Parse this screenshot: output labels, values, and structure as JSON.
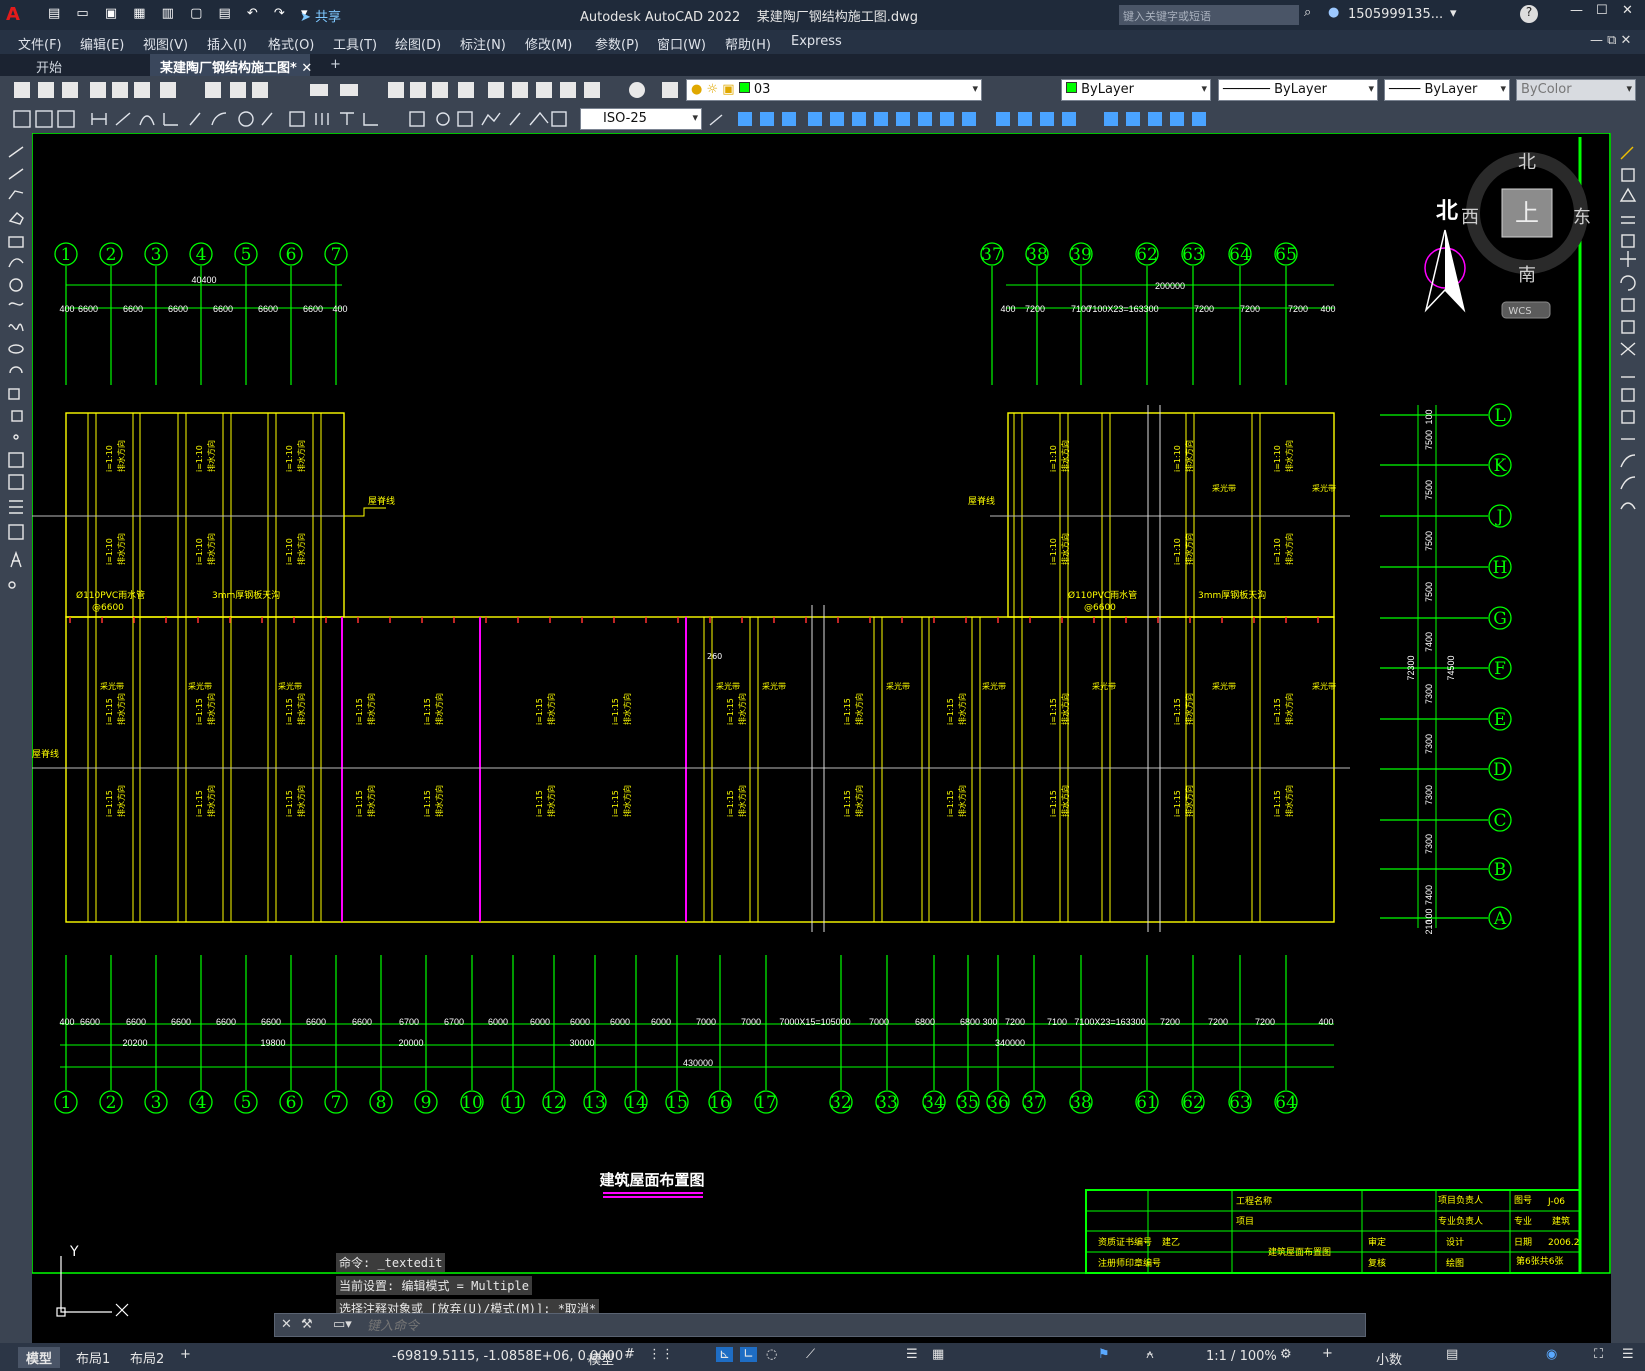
{
  "window": {
    "app_title": "Autodesk AutoCAD 2022",
    "file_title": "某建陶厂钢结构施工图.dwg",
    "share_label": "共享",
    "search_placeholder": "键入关键字或短语",
    "user": "1505999135...",
    "help_label": "?"
  },
  "menus": [
    "文件(F)",
    "编辑(E)",
    "视图(V)",
    "插入(I)",
    "格式(O)",
    "工具(T)",
    "绘图(D)",
    "标注(N)",
    "修改(M)",
    "参数(P)",
    "窗口(W)",
    "帮助(H)",
    "Express"
  ],
  "tabs": {
    "start": "开始",
    "doc": "某建陶厂钢结构施工图*",
    "add": "+"
  },
  "toolbar": {
    "layer": "03",
    "color": "ByLayer",
    "linetype": "ByLayer",
    "lineweight": "ByLayer",
    "plotstyle": "ByColor",
    "dimstyle": "ISO-25"
  },
  "viewcube": {
    "north": "北",
    "south": "南",
    "east": "东",
    "west": "西",
    "top": "上",
    "compass": "北",
    "wcs": "WCS"
  },
  "drawing": {
    "title": "建筑屋面布置图",
    "top_left_axes": [
      "1",
      "2",
      "3",
      "4",
      "5",
      "6",
      "7"
    ],
    "top_left_total": "40400",
    "top_left_dims": [
      "400",
      "6600",
      "6600",
      "6600",
      "6600",
      "6600",
      "6600",
      "400"
    ],
    "top_right_axes": [
      "37",
      "38",
      "39",
      "62",
      "63",
      "64",
      "65"
    ],
    "top_right_total": "200000",
    "top_right_dims": [
      "400",
      "7200",
      "7100",
      "7100X23=163300",
      "7200",
      "7200",
      "7200",
      "400"
    ],
    "bottom_axes": [
      "1",
      "2",
      "3",
      "4",
      "5",
      "6",
      "7",
      "8",
      "9",
      "10",
      "11",
      "12",
      "13",
      "14",
      "15",
      "16",
      "17",
      "32",
      "33",
      "34",
      "35",
      "36",
      "37",
      "38",
      "61",
      "62",
      "63",
      "64"
    ],
    "bottom_dims": [
      "400",
      "6600",
      "6600",
      "6600",
      "6600",
      "6600",
      "6600",
      "6600",
      "6700",
      "6700",
      "6000",
      "6000",
      "6000",
      "6000",
      "6000",
      "7000",
      "7000",
      "7000X15=105000",
      "7000",
      "6800",
      "6800",
      "300",
      "7200",
      "7100",
      "7100X23=163300",
      "7200",
      "7200",
      "7200",
      "400"
    ],
    "bottom_groups": [
      "20200",
      "19800",
      "20000",
      "30000",
      "340000"
    ],
    "bottom_total": "430000",
    "right_axes": [
      "L",
      "K",
      "J",
      "H",
      "G",
      "F",
      "E",
      "D",
      "C",
      "B",
      "A"
    ],
    "right_dims": [
      "100",
      "7500",
      "7500",
      "7500",
      "7500",
      "7400",
      "7300",
      "7300",
      "7300",
      "7300",
      "7400",
      "100",
      "210"
    ],
    "right_totals": [
      "72300",
      "74500"
    ],
    "labels": {
      "ridge": "屋脊线",
      "pipe": "Ø110PVC雨水管",
      "pipe_spacing": "@6600",
      "gutter": "3mm厚钢板天沟",
      "skylight": "采光带",
      "slope_top": "i=1:10",
      "slope_bottom": "i=1:15",
      "drain": "排水方向",
      "dim260": "260"
    }
  },
  "title_block": {
    "project_name": "工程名称",
    "project": "项目",
    "project_lead": "项目负责人",
    "discipline_lead": "专业负责人",
    "drawing_no_label": "图号",
    "drawing_no": "J-06",
    "discipline_label": "专业",
    "discipline": "建筑",
    "cert_no": "资质证书编号",
    "seal": "建乙",
    "reg_seal": "注册师印章编号",
    "drawing_name": "建筑屋面布置图",
    "approve": "审定",
    "check": "复核",
    "design": "设计",
    "draw": "绘图",
    "date_label": "日期",
    "date": "2006.2",
    "sheet": "第6张共6张"
  },
  "command": {
    "history": [
      "命令: _textedit",
      "当前设置: 编辑模式 = Multiple",
      "选择注释对象或 [放弃(U)/模式(M)]: *取消*"
    ],
    "placeholder": "键入命令"
  },
  "layouts": [
    "模型",
    "布局1",
    "布局2",
    "+"
  ],
  "status": {
    "coords": "-69819.5115, -1.0858E+06, 0.0000",
    "space": "模型",
    "scale": "1:1 / 100%",
    "units": "小数"
  },
  "ucs": {
    "x": "X",
    "y": "Y"
  },
  "colors": {
    "grid": "#00ff00",
    "outline": "#ffff00",
    "magenta": "#ff00ff",
    "ui": "#3b4452"
  }
}
